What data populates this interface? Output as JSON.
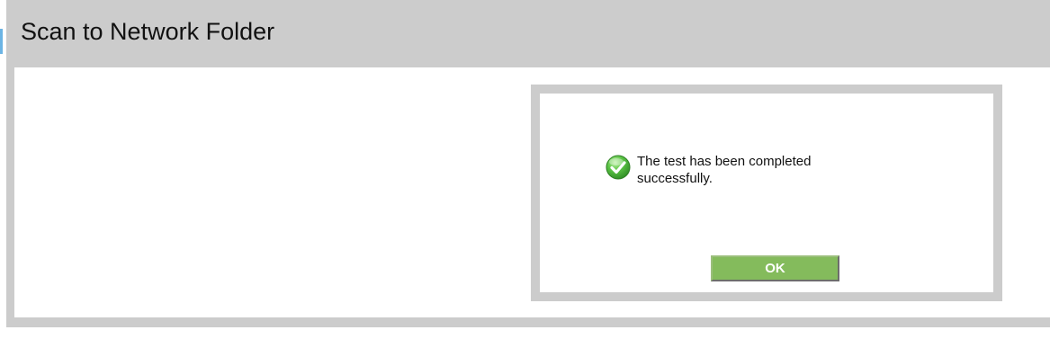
{
  "window": {
    "title": "Scan to Network Folder"
  },
  "dialog": {
    "icon": "check-circle-icon",
    "message": "The test has been completed successfully.",
    "ok_label": "OK"
  },
  "colors": {
    "frame": "#cccccc",
    "accent": "#6cb4e4",
    "ok_button": "#84bb5c",
    "success_icon": "#4caf3f"
  }
}
